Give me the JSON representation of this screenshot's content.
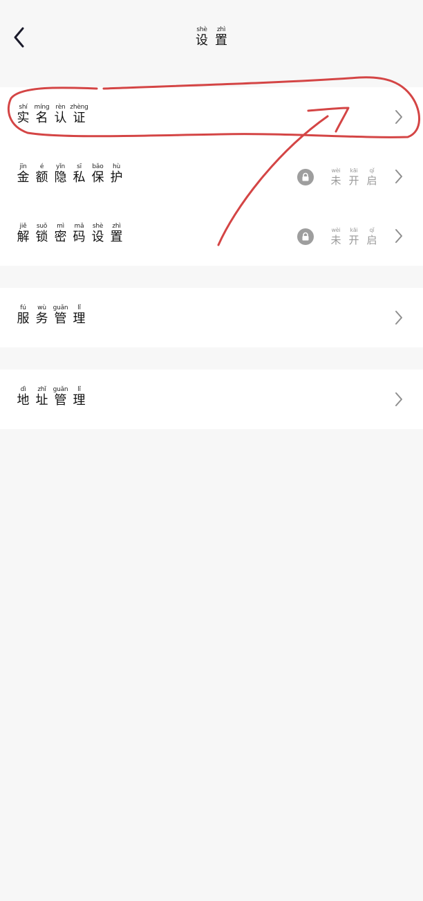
{
  "header": {
    "title": [
      {
        "pinyin": "shè",
        "hanzi": "设"
      },
      {
        "pinyin": "zhì",
        "hanzi": "置"
      }
    ]
  },
  "section1": {
    "rows": [
      {
        "label": [
          {
            "pinyin": "shí",
            "hanzi": "实"
          },
          {
            "pinyin": "míng",
            "hanzi": "名"
          },
          {
            "pinyin": "rèn",
            "hanzi": "认"
          },
          {
            "pinyin": "zhèng",
            "hanzi": "证"
          }
        ]
      },
      {
        "label": [
          {
            "pinyin": "jīn",
            "hanzi": "金"
          },
          {
            "pinyin": "é",
            "hanzi": "额"
          },
          {
            "pinyin": "yǐn",
            "hanzi": "隐"
          },
          {
            "pinyin": "sī",
            "hanzi": "私"
          },
          {
            "pinyin": "bǎo",
            "hanzi": "保"
          },
          {
            "pinyin": "hù",
            "hanzi": "护"
          }
        ],
        "status": [
          {
            "pinyin": "wèi",
            "hanzi": "未"
          },
          {
            "pinyin": "kāi",
            "hanzi": "开"
          },
          {
            "pinyin": "qǐ",
            "hanzi": "启"
          }
        ]
      },
      {
        "label": [
          {
            "pinyin": "jiě",
            "hanzi": "解"
          },
          {
            "pinyin": "suǒ",
            "hanzi": "锁"
          },
          {
            "pinyin": "mì",
            "hanzi": "密"
          },
          {
            "pinyin": "mǎ",
            "hanzi": "码"
          },
          {
            "pinyin": "shè",
            "hanzi": "设"
          },
          {
            "pinyin": "zhì",
            "hanzi": "置"
          }
        ],
        "status": [
          {
            "pinyin": "wèi",
            "hanzi": "未"
          },
          {
            "pinyin": "kāi",
            "hanzi": "开"
          },
          {
            "pinyin": "qǐ",
            "hanzi": "启"
          }
        ]
      }
    ]
  },
  "section2": {
    "rows": [
      {
        "label": [
          {
            "pinyin": "fú",
            "hanzi": "服"
          },
          {
            "pinyin": "wù",
            "hanzi": "务"
          },
          {
            "pinyin": "guǎn",
            "hanzi": "管"
          },
          {
            "pinyin": "lǐ",
            "hanzi": "理"
          }
        ]
      }
    ]
  },
  "section3": {
    "rows": [
      {
        "label": [
          {
            "pinyin": "dì",
            "hanzi": "地"
          },
          {
            "pinyin": "zhǐ",
            "hanzi": "址"
          },
          {
            "pinyin": "guǎn",
            "hanzi": "管"
          },
          {
            "pinyin": "lǐ",
            "hanzi": "理"
          }
        ]
      }
    ]
  },
  "colors": {
    "annotation": "#d44545",
    "background": "#f7f7f7",
    "row": "#ffffff"
  },
  "icons": {
    "back": "chevron-left-icon",
    "chevron": "chevron-right-icon",
    "lock": "lock-icon"
  }
}
